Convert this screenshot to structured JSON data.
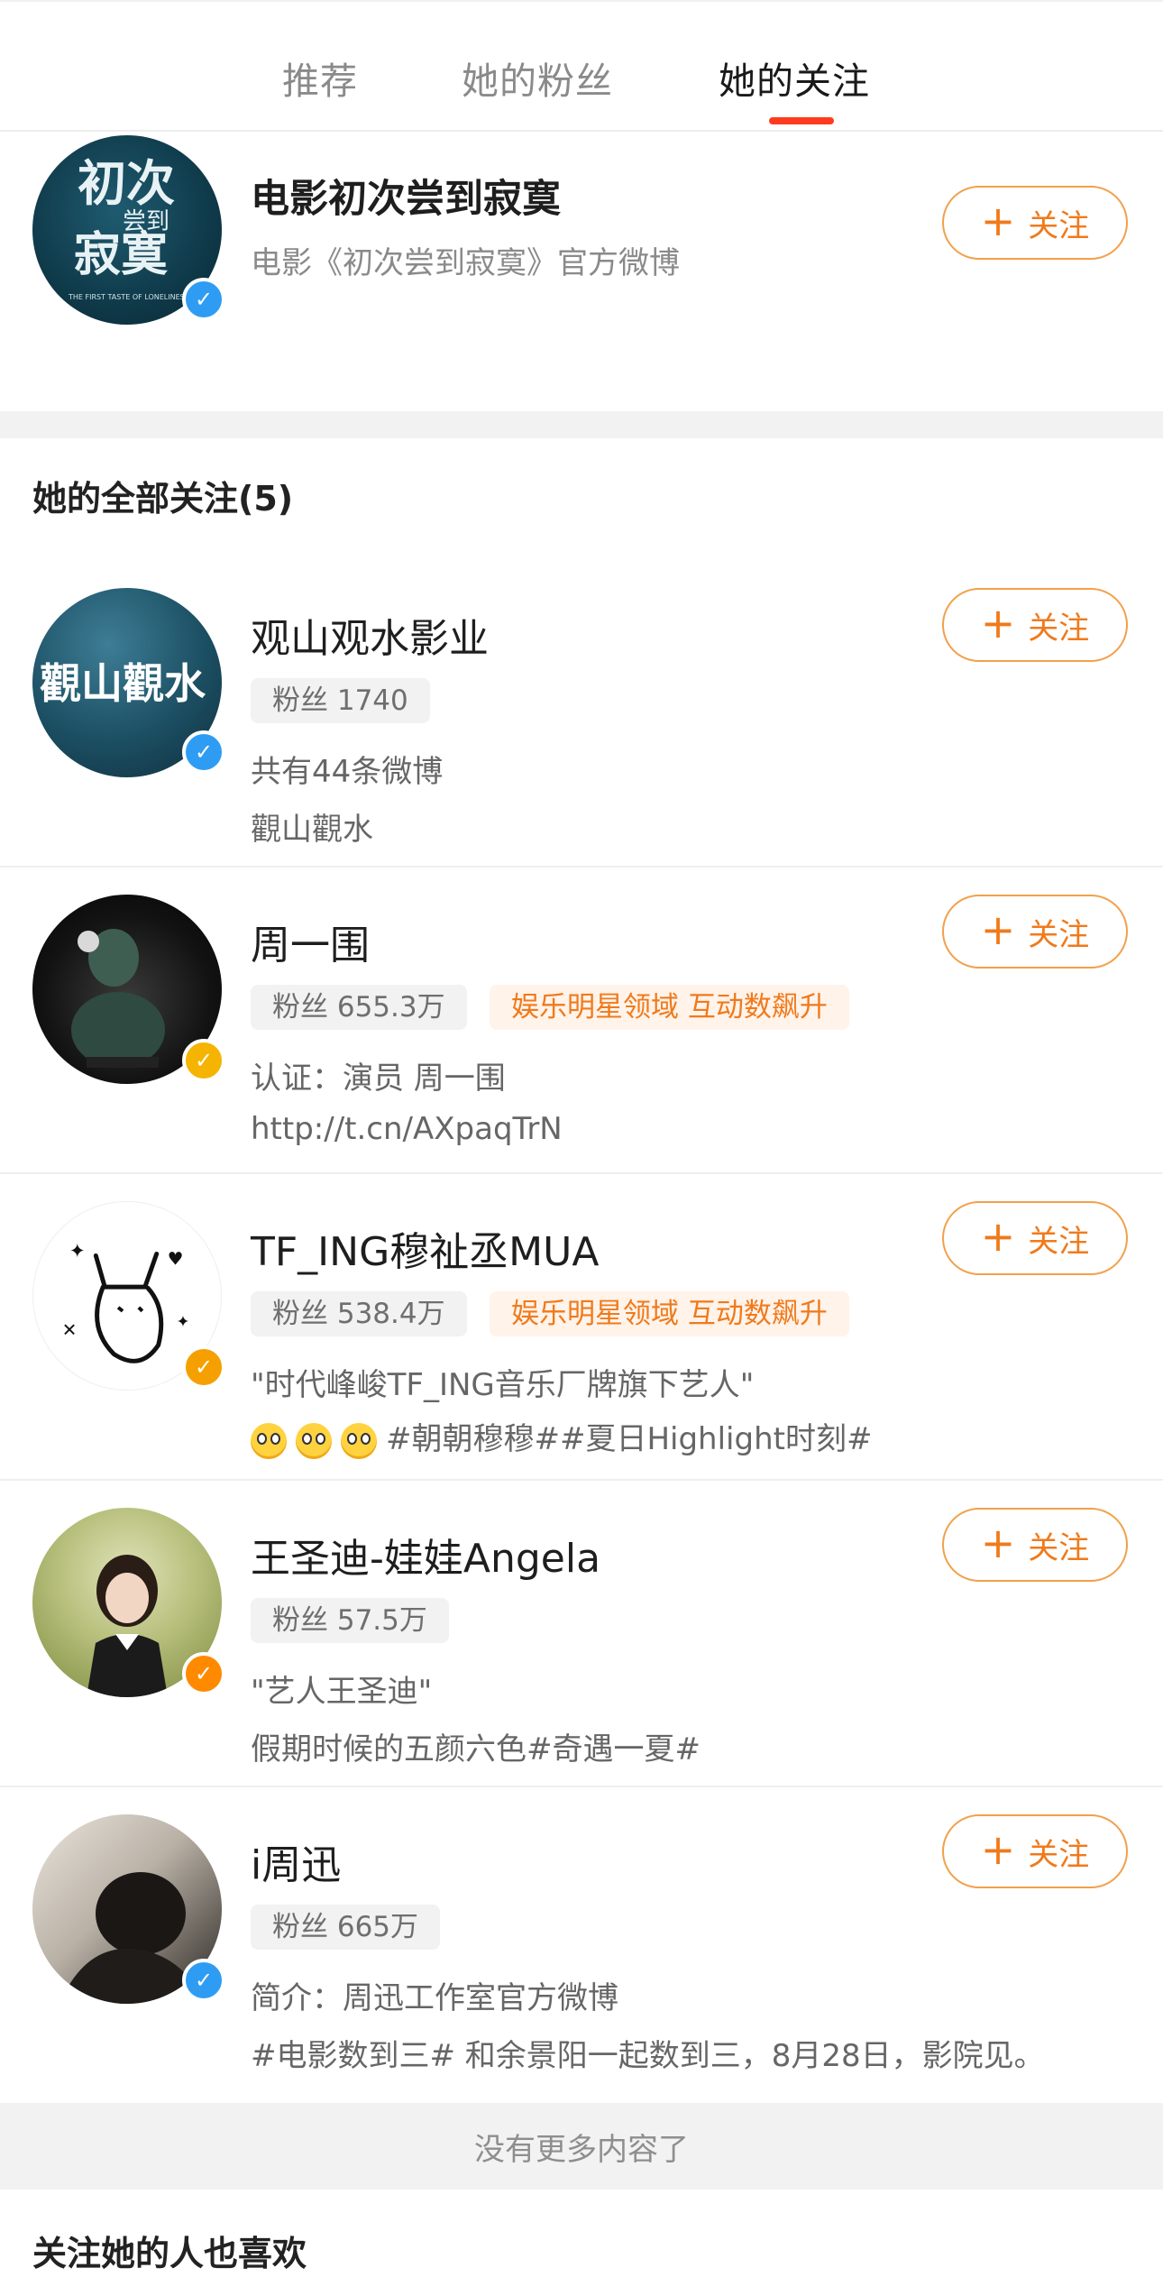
{
  "tabs": [
    {
      "label": "推荐"
    },
    {
      "label": "她的粉丝"
    },
    {
      "label": "她的关注"
    }
  ],
  "featured": {
    "name": "电影初次尝到寂寞",
    "desc": "电影《初次尝到寂寞》官方微博",
    "avatar_text": "初次尝到寂寞",
    "avatar_caption": "THE FIRST TASTE OF LONELINESS"
  },
  "follow_label": "关注",
  "list_title": "她的全部关注(5)",
  "users": [
    {
      "name": "观山观水影业",
      "fans": "粉丝 1740",
      "line1": "共有44条微博",
      "line2": "觀山觀水",
      "avatar_text": "觀山觀水",
      "badge": "V"
    },
    {
      "name": "周一围",
      "fans": "粉丝 655.3万",
      "tag": "娱乐明星领域 互动数飙升",
      "line1": "认证：演员 周一围",
      "line2": "http://t.cn/AXpaqTrN",
      "badge": "V"
    },
    {
      "name": "TF_ING穆祉丞MUA",
      "fans": "粉丝 538.4万",
      "tag": "娱乐明星领域 互动数飙升",
      "line1": "\"时代峰峻TF_ING音乐厂牌旗下艺人\"",
      "line2": "#朝朝穆穆##夏日Highlight时刻#",
      "badge": "V"
    },
    {
      "name": "王圣迪-娃娃Angela",
      "fans": "粉丝 57.5万",
      "line1": "\"艺人王圣迪\"",
      "line2": "假期时候的五颜六色#奇遇一夏#",
      "badge": "V"
    },
    {
      "name": "i周迅",
      "fans": "粉丝 665万",
      "line1": "简介：周迅工作室官方微博",
      "line2": "#电影数到三# 和余景阳一起数到三，8月28日，影院见。",
      "badge": "V"
    }
  ],
  "no_more": "没有更多内容了",
  "recommend_title": "关注她的人也喜欢",
  "colors": {
    "accent_orange": "#f07a1b",
    "tab_indicator": "#ff3b1f",
    "verified_blue": "#2f9cf3",
    "verified_gold": "#f5b400",
    "verified_orange": "#ff8a00"
  }
}
